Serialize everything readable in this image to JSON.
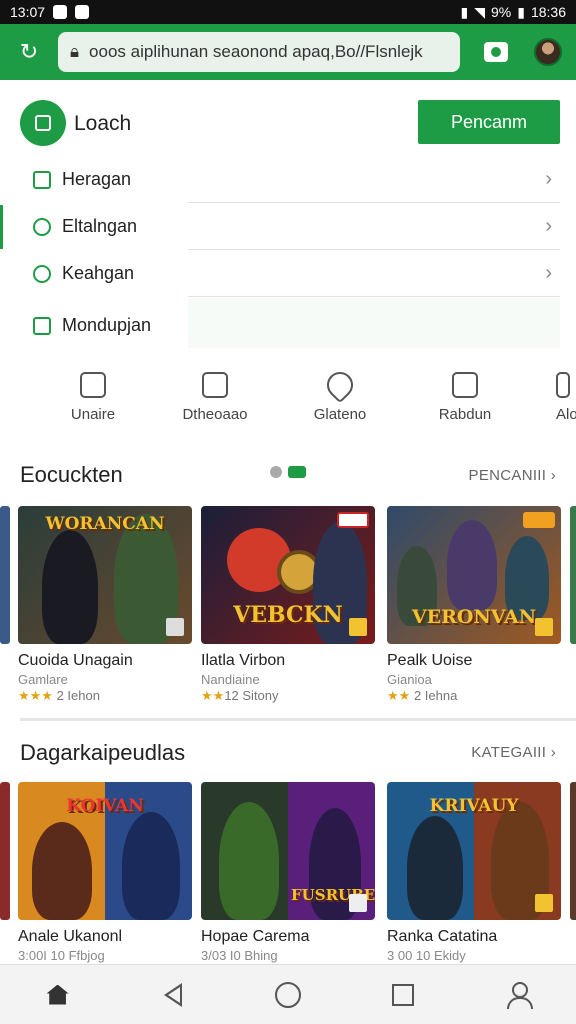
{
  "status": {
    "time_left": "13:07",
    "battery": "9%",
    "time_right": "18:36"
  },
  "url_bar": {
    "text": "ooos aiplihunan seaonond apaq,Bo//Flsnlejk"
  },
  "panel": {
    "title": "Loach",
    "button_label": "Pencanm",
    "items": [
      {
        "label": "Heragan",
        "icon": "square-icon"
      },
      {
        "label": "Eltalngan",
        "icon": "search-icon"
      },
      {
        "label": "Keahgan",
        "icon": "clock-icon"
      },
      {
        "label": "Mondupjan",
        "icon": "image-icon"
      }
    ]
  },
  "categories": [
    {
      "label": "Unaire",
      "icon": "tools-icon"
    },
    {
      "label": "Dtheoaao",
      "icon": "frame-icon"
    },
    {
      "label": "Glateno",
      "icon": "pin-icon"
    },
    {
      "label": "Rabdun",
      "icon": "board-icon"
    },
    {
      "label": "Alo",
      "icon": "person-icon"
    }
  ],
  "section1": {
    "title": "Eocuckten",
    "link": "PENCANIII",
    "cards": [
      {
        "name": "Cuoida Unagain",
        "sub": "Gamlare",
        "stars": "★★★",
        "rating": "2 Iehon",
        "art_title": "WORANCAN",
        "colors": [
          "#2a3d3a",
          "#6a4a2e"
        ]
      },
      {
        "name": "Ilatla Virbon",
        "sub": "Nandiaine",
        "stars": "★★",
        "rating": "12 Sitony",
        "art_title": "VEBCKN",
        "colors": [
          "#1a1f3a",
          "#7a1c1c"
        ]
      },
      {
        "name": "Pealk Uoise",
        "sub": "Gianioa",
        "stars": "★★",
        "rating": "2 Iehna",
        "art_title": "VERONVAN",
        "colors": [
          "#2f4a6a",
          "#a05a20"
        ]
      }
    ]
  },
  "section2": {
    "title": "Dagarkaipeudlas",
    "link": "KATEGAIII",
    "cards": [
      {
        "name": "Anale Ukanonl",
        "sub": "3:00I 10 Ffbjog",
        "art_title": "KOIVAN",
        "colors": [
          "#d88a20",
          "#2a4a8a"
        ]
      },
      {
        "name": "Hopae Carema",
        "sub": "3/03 I0 Bhing",
        "art_title": "FUSRUBE",
        "colors": [
          "#2a3a2a",
          "#5a1f7a"
        ]
      },
      {
        "name": "Ranka Catatina",
        "sub": "3 00 10 Ekidy",
        "art_title": "KRIVAUY",
        "colors": [
          "#1f5a8a",
          "#8a3a20"
        ]
      }
    ]
  },
  "bottom_nav": [
    "home-icon",
    "back-icon",
    "circle-icon",
    "square-icon",
    "profile-icon"
  ]
}
